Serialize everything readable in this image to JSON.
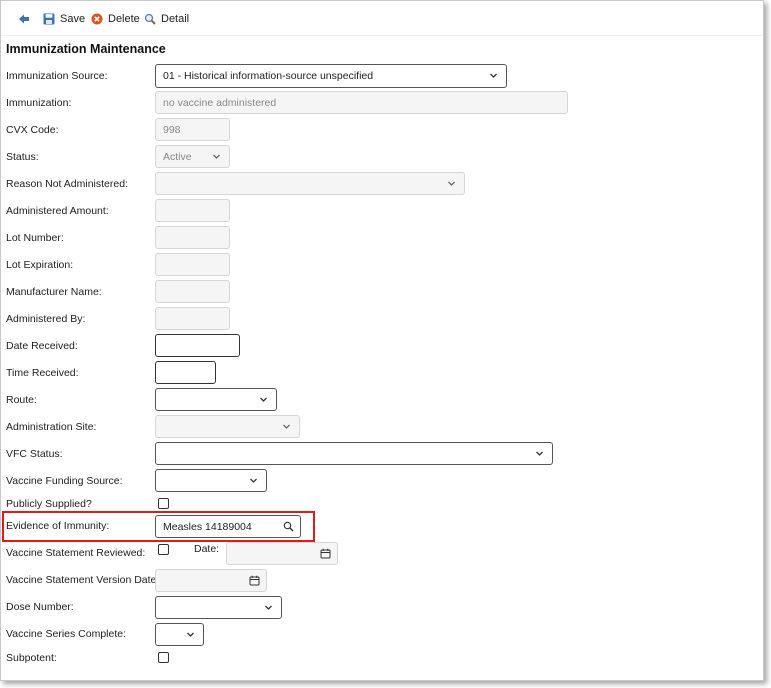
{
  "toolbar": {
    "back_icon": "back-arrow-icon",
    "save_label": "Save",
    "delete_label": "Delete",
    "detail_label": "Detail"
  },
  "page_title": "Immunization Maintenance",
  "fields": {
    "immunization_source": {
      "label": "Immunization Source:",
      "value": "01 - Historical information-source unspecified"
    },
    "immunization": {
      "label": "Immunization:",
      "placeholder": "no vaccine administered"
    },
    "cvx_code": {
      "label": "CVX Code:",
      "value": "998"
    },
    "status": {
      "label": "Status:",
      "value": "Active"
    },
    "reason_not_administered": {
      "label": "Reason Not Administered:",
      "value": ""
    },
    "administered_amount": {
      "label": "Administered Amount:"
    },
    "lot_number": {
      "label": "Lot Number:"
    },
    "lot_expiration": {
      "label": "Lot Expiration:"
    },
    "manufacturer_name": {
      "label": "Manufacturer Name:"
    },
    "administered_by": {
      "label": "Administered By:"
    },
    "date_received": {
      "label": "Date Received:"
    },
    "time_received": {
      "label": "Time Received:"
    },
    "route": {
      "label": "Route:"
    },
    "administration_site": {
      "label": "Administration Site:"
    },
    "vfc_status": {
      "label": "VFC Status:"
    },
    "vaccine_funding_source": {
      "label": "Vaccine Funding Source:"
    },
    "publicly_supplied": {
      "label": "Publicly Supplied?"
    },
    "evidence_of_immunity": {
      "label": "Evidence of Immunity:",
      "value": "Measles 14189004"
    },
    "vaccine_statement_reviewed": {
      "label": "Vaccine Statement Reviewed:",
      "date_label": "Date:"
    },
    "vaccine_statement_version_date": {
      "label": "Vaccine Statement Version Date:"
    },
    "dose_number": {
      "label": "Dose Number:"
    },
    "vaccine_series_complete": {
      "label": "Vaccine Series Complete:"
    },
    "subpotent": {
      "label": "Subpotent:"
    }
  },
  "colors": {
    "highlight": "#e01b1b",
    "icon_blue": "#3b6fb6",
    "delete_red": "#d9541e"
  }
}
